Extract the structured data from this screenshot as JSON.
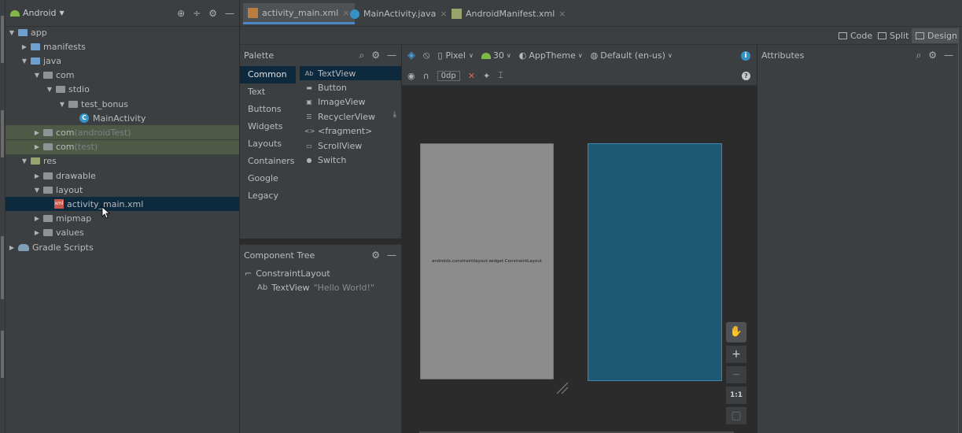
{
  "project": {
    "view": "Android",
    "tree": [
      {
        "label": "app",
        "depth": 0,
        "arrow": "▼",
        "icon": "app"
      },
      {
        "label": "manifests",
        "depth": 1,
        "arrow": "▶",
        "icon": "blue"
      },
      {
        "label": "java",
        "depth": 1,
        "arrow": "▼",
        "icon": "blue"
      },
      {
        "label": "com",
        "depth": 2,
        "arrow": "▼",
        "icon": "gray"
      },
      {
        "label": "stdio",
        "depth": 3,
        "arrow": "▼",
        "icon": "gray"
      },
      {
        "label": "test_bonus",
        "depth": 4,
        "arrow": "▼",
        "icon": "gray"
      },
      {
        "label": "MainActivity",
        "depth": 5,
        "arrow": "",
        "icon": "class"
      },
      {
        "label": "com",
        "suffix": "(androidTest)",
        "depth": 2,
        "arrow": "▶",
        "icon": "gray",
        "test": true
      },
      {
        "label": "com",
        "suffix": "(test)",
        "depth": 2,
        "arrow": "▶",
        "icon": "gray",
        "test": true
      },
      {
        "label": "res",
        "depth": 1,
        "arrow": "▼",
        "icon": "green"
      },
      {
        "label": "drawable",
        "depth": 2,
        "arrow": "▶",
        "icon": "gray"
      },
      {
        "label": "layout",
        "depth": 2,
        "arrow": "▼",
        "icon": "gray"
      },
      {
        "label": "activity_main.xml",
        "depth": 3,
        "arrow": "",
        "icon": "xml",
        "selected": true
      },
      {
        "label": "mipmap",
        "depth": 2,
        "arrow": "▶",
        "icon": "gray"
      },
      {
        "label": "values",
        "depth": 2,
        "arrow": "▶",
        "icon": "gray"
      },
      {
        "label": "Gradle Scripts",
        "depth": 0,
        "arrow": "▶",
        "icon": "gradle"
      }
    ]
  },
  "tabs": [
    {
      "label": "activity_main.xml",
      "icon": "xml",
      "active": true
    },
    {
      "label": "MainActivity.java",
      "icon": "java",
      "active": false
    },
    {
      "label": "AndroidManifest.xml",
      "icon": "manifest",
      "active": false
    }
  ],
  "modes": {
    "code": "Code",
    "split": "Split",
    "design": "Design"
  },
  "palette": {
    "title": "Palette",
    "categories": [
      "Common",
      "Text",
      "Buttons",
      "Widgets",
      "Layouts",
      "Containers",
      "Google",
      "Legacy"
    ],
    "items": [
      {
        "icon": "Ab",
        "label": "TextView"
      },
      {
        "icon": "▬",
        "label": "Button"
      },
      {
        "icon": "▣",
        "label": "ImageView"
      },
      {
        "icon": "☰",
        "label": "RecyclerView"
      },
      {
        "icon": "<>",
        "label": "<fragment>"
      },
      {
        "icon": "▭",
        "label": "ScrollView"
      },
      {
        "icon": "●",
        "label": "Switch"
      }
    ]
  },
  "component_tree": {
    "title": "Component Tree",
    "root": "ConstraintLayout",
    "child_icon": "Ab",
    "child": "TextView",
    "child_value": "\"Hello World!\""
  },
  "design_toolbar": {
    "device": "Pixel",
    "api": "30",
    "theme": "AppTheme",
    "locale": "Default (en-us)",
    "margin": "0dp"
  },
  "canvas": {
    "layout_label": "androidx.constraintlayout.widget.ConstraintLayout",
    "zoom_fit": "1:1"
  },
  "attributes": {
    "title": "Attributes"
  }
}
